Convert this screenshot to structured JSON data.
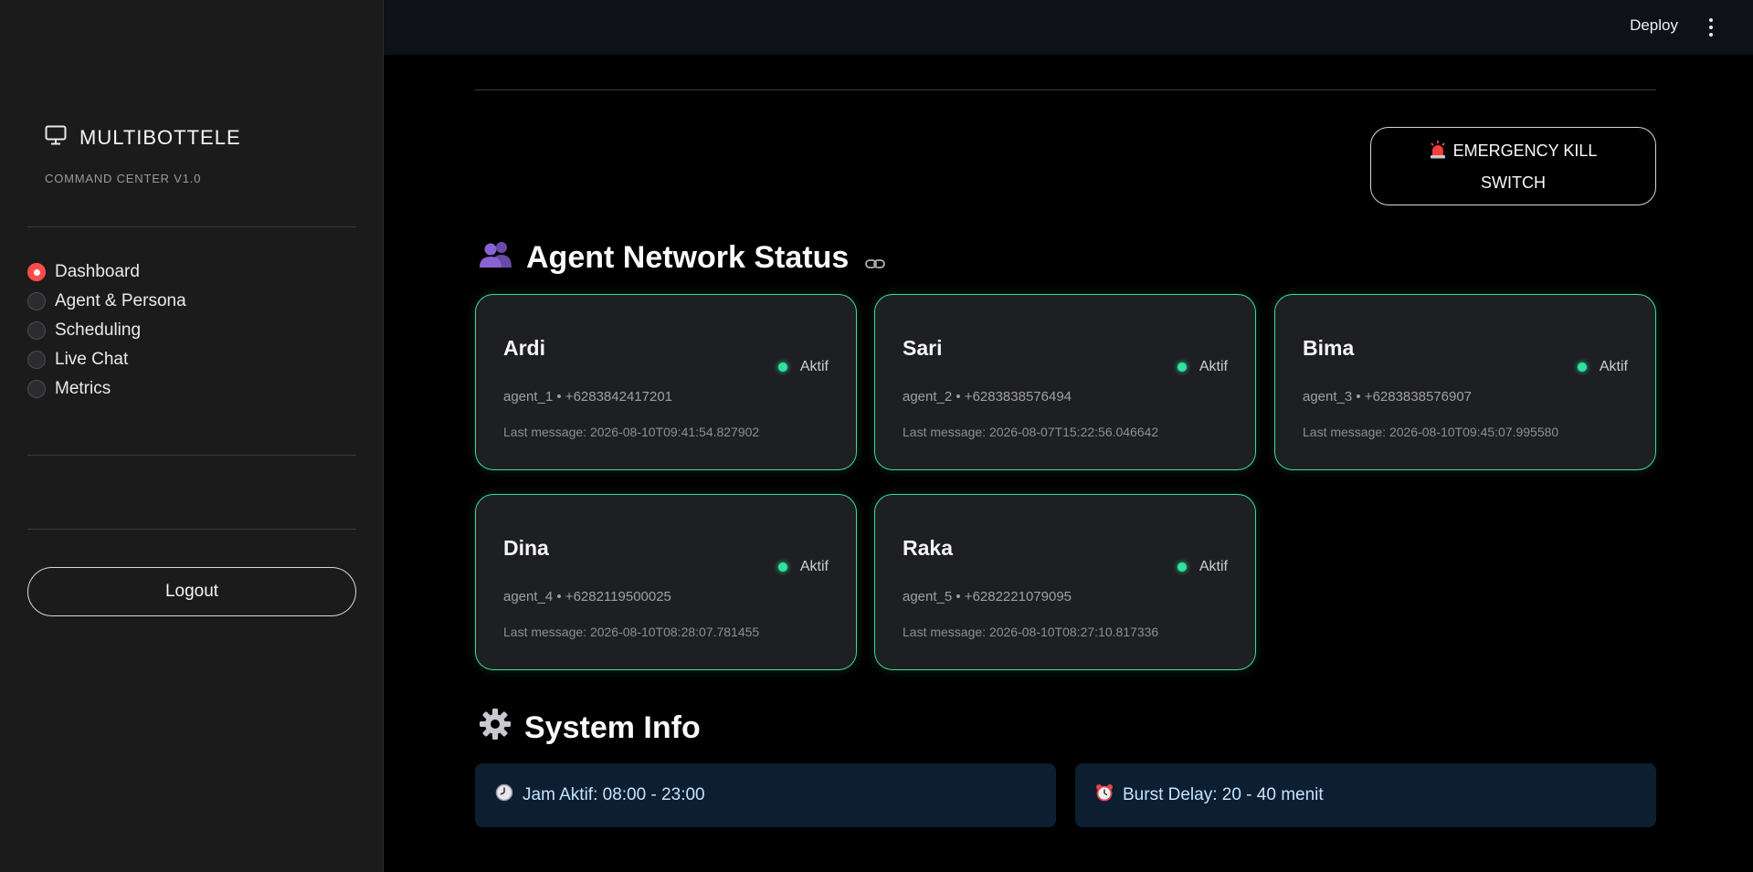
{
  "header": {
    "deploy_label": "Deploy"
  },
  "sidebar": {
    "brand_title": "MULTIBOTTELE",
    "brand_subtitle": "COMMAND CENTER V1.0",
    "nav": [
      {
        "label": "Dashboard",
        "selected": true
      },
      {
        "label": "Agent & Persona",
        "selected": false
      },
      {
        "label": "Scheduling",
        "selected": false
      },
      {
        "label": "Live Chat",
        "selected": false
      },
      {
        "label": "Metrics",
        "selected": false
      }
    ],
    "logout_label": "Logout"
  },
  "main": {
    "kill_switch_label": "EMERGENCY KILL SWITCH",
    "agent_section_title": "Agent Network Status",
    "agents": [
      {
        "name": "Ardi",
        "status": "Aktif",
        "meta": "agent_1 • +6283842417201",
        "last_message": "Last message: 2026-08-10T09:41:54.827902"
      },
      {
        "name": "Sari",
        "status": "Aktif",
        "meta": "agent_2 • +6283838576494",
        "last_message": "Last message: 2026-08-07T15:22:56.046642"
      },
      {
        "name": "Bima",
        "status": "Aktif",
        "meta": "agent_3 • +6283838576907",
        "last_message": "Last message: 2026-08-10T09:45:07.995580"
      },
      {
        "name": "Dina",
        "status": "Aktif",
        "meta": "agent_4 • +6282119500025",
        "last_message": "Last message: 2026-08-10T08:28:07.781455"
      },
      {
        "name": "Raka",
        "status": "Aktif",
        "meta": "agent_5 • +6282221079095",
        "last_message": "Last message: 2026-08-10T08:27:10.817336"
      }
    ],
    "system_section_title": "System Info",
    "system_info": [
      {
        "text": "Jam Aktif: 08:00 - 23:00",
        "icon": "clock-icon"
      },
      {
        "text": "Burst Delay: 20 - 40 menit",
        "icon": "alarm-clock-icon"
      }
    ]
  },
  "colors": {
    "accent_red": "#ff4b4b",
    "card_border_green": "#3ddc97",
    "status_dot_green": "#2ee59d",
    "info_background": "#0c1e30"
  }
}
